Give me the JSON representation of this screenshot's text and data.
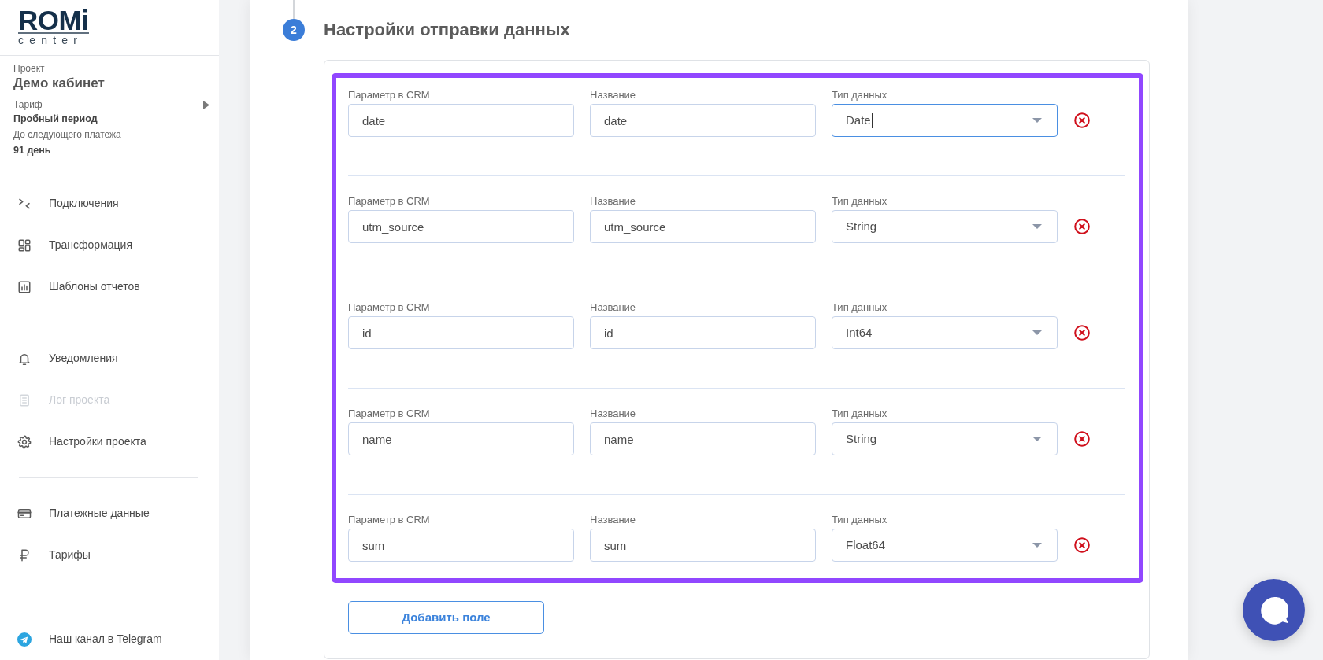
{
  "sidebar": {
    "logo": {
      "wordmark": "ROMi",
      "subtitle": "center"
    },
    "project": {
      "label": "Проект",
      "name": "Демо кабинет",
      "plan_label": "Тариф",
      "plan": "Пробный период",
      "next_payment_label": "До следующего платежа",
      "next_payment": "91 день"
    },
    "menu_groups": [
      {
        "items": [
          {
            "label": "Подключения",
            "disabled": false
          },
          {
            "label": "Трансформация",
            "disabled": false
          },
          {
            "label": "Шаблоны отчетов",
            "disabled": false
          }
        ]
      },
      {
        "items": [
          {
            "label": "Уведомления",
            "disabled": false
          },
          {
            "label": "Лог проекта",
            "disabled": true
          },
          {
            "label": "Настройки проекта",
            "disabled": false
          }
        ]
      },
      {
        "items": [
          {
            "label": "Платежные данные",
            "disabled": false
          },
          {
            "label": "Тарифы",
            "disabled": false
          }
        ]
      }
    ],
    "telegram_link": "Наш канал в Telegram"
  },
  "step": {
    "number": "2",
    "title": "Настройки отправки данных"
  },
  "fields": [
    {
      "parameter_label": "Параметр в CRM",
      "parameter": "date",
      "name_label": "Название",
      "name": "date",
      "type_label": "Тип данных",
      "type": "Date",
      "focused": true
    },
    {
      "parameter_label": "Параметр в CRM",
      "parameter": "utm_source",
      "name_label": "Название",
      "name": "utm_source",
      "type_label": "Тип данных",
      "type": "String",
      "focused": false
    },
    {
      "parameter_label": "Параметр в CRM",
      "parameter": "id",
      "name_label": "Название",
      "name": "id",
      "type_label": "Тип данных",
      "type": "Int64",
      "focused": false
    },
    {
      "parameter_label": "Параметр в CRM",
      "parameter": "name",
      "name_label": "Название",
      "name": "name",
      "type_label": "Тип данных",
      "type": "String",
      "focused": false
    },
    {
      "parameter_label": "Параметр в CRM",
      "parameter": "sum",
      "name_label": "Название",
      "name": "sum",
      "type_label": "Тип данных",
      "type": "Float64",
      "focused": false
    }
  ],
  "add_button": "Добавить поле"
}
